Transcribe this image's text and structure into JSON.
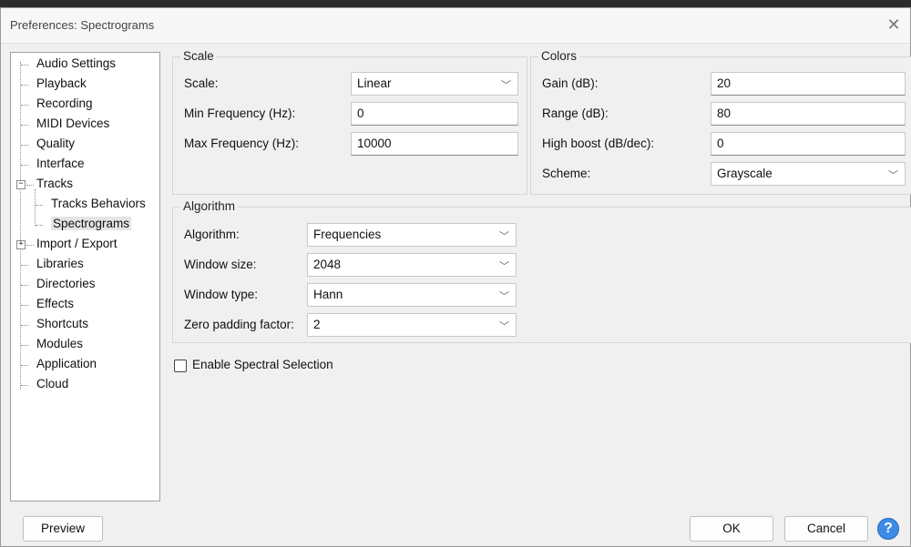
{
  "window": {
    "title": "Preferences: Spectrograms",
    "close_glyph": "✕"
  },
  "tree": {
    "items": [
      {
        "label": "Audio Settings"
      },
      {
        "label": "Playback"
      },
      {
        "label": "Recording"
      },
      {
        "label": "MIDI Devices"
      },
      {
        "label": "Quality"
      },
      {
        "label": "Interface"
      },
      {
        "label": "Tracks",
        "expanded": true
      },
      {
        "label": "Tracks Behaviors"
      },
      {
        "label": "Spectrograms",
        "selected": true
      },
      {
        "label": "Import / Export",
        "expanded": false
      },
      {
        "label": "Libraries"
      },
      {
        "label": "Directories"
      },
      {
        "label": "Effects"
      },
      {
        "label": "Shortcuts"
      },
      {
        "label": "Modules"
      },
      {
        "label": "Application"
      },
      {
        "label": "Cloud"
      }
    ],
    "expander_minus": "−",
    "expander_plus": "+"
  },
  "scale": {
    "title": "Scale",
    "scale_label": "Scale:",
    "scale_value": "Linear",
    "min_label": "Min Frequency (Hz):",
    "min_value": "0",
    "max_label": "Max Frequency (Hz):",
    "max_value": "10000"
  },
  "colors": {
    "title": "Colors",
    "gain_label": "Gain (dB):",
    "gain_value": "20",
    "range_label": "Range (dB):",
    "range_value": "80",
    "boost_label": "High boost (dB/dec):",
    "boost_value": "0",
    "scheme_label": "Scheme:",
    "scheme_value": "Grayscale"
  },
  "algorithm": {
    "title": "Algorithm",
    "algorithm_label": "Algorithm:",
    "algorithm_value": "Frequencies",
    "window_size_label": "Window size:",
    "window_size_value": "2048",
    "window_type_label": "Window type:",
    "window_type_value": "Hann",
    "zero_padding_label": "Zero padding factor:",
    "zero_padding_value": "2"
  },
  "spectral_selection": {
    "label": "Enable Spectral Selection",
    "checked": false
  },
  "buttons": {
    "preview": "Preview",
    "ok": "OK",
    "cancel": "Cancel",
    "help": "?"
  },
  "chevron": "﹀"
}
